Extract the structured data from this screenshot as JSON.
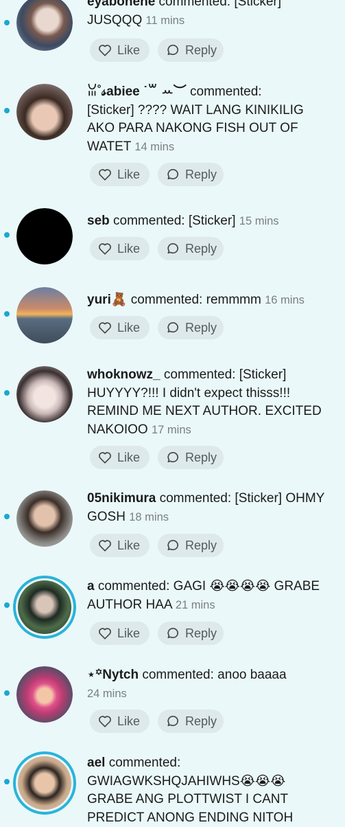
{
  "labels": {
    "like": "Like",
    "reply": "Reply"
  },
  "comments": [
    {
      "user": "eyabonene",
      "action": " commented: [Sticker]",
      "body": "JUSQQQ",
      "time": "11 mins"
    },
    {
      "user": "ꈍ˚𝓈abiee ˙꒳ ꕀ︶",
      "action": " commented:",
      "body": "[Sticker] ???? WAIT LANG KINIKILIG AKO PARA NAKONG FISH OUT OF WATET",
      "time": "14 mins"
    },
    {
      "user": "seb",
      "action": " commented: [Sticker]",
      "body": "",
      "time": "15 mins"
    },
    {
      "user": "yuri🧸",
      "action": " commented: remmmm",
      "body": "",
      "time": "16 mins"
    },
    {
      "user": "whoknowz_",
      "action": " commented: [Sticker]",
      "body": "HUYYYY?!!! I didn't expect thisss!!! REMIND ME NEXT AUTHOR. EXCITED NAKOIOO",
      "time": "17 mins"
    },
    {
      "user": "05nikimura",
      "action": " commented: [Sticker] OHMY",
      "body": "GOSH",
      "time": "18 mins"
    },
    {
      "user": "a",
      "action": " commented: GAGI 😭😭😭😭 GRABE",
      "body": "AUTHOR HAA",
      "time": "21 mins"
    },
    {
      "user": "⋆꙳Nytch",
      "action": " commented: anoo baaaa",
      "body": "",
      "time": "24 mins"
    },
    {
      "user": "ael",
      "action": " commented:",
      "body": "GWIAGWKSHQJAHIWHS😭😭😭 GRABE ANG PLOTTWIST I CANT PREDICT ANONG ENDING NITOH",
      "time": ""
    }
  ]
}
